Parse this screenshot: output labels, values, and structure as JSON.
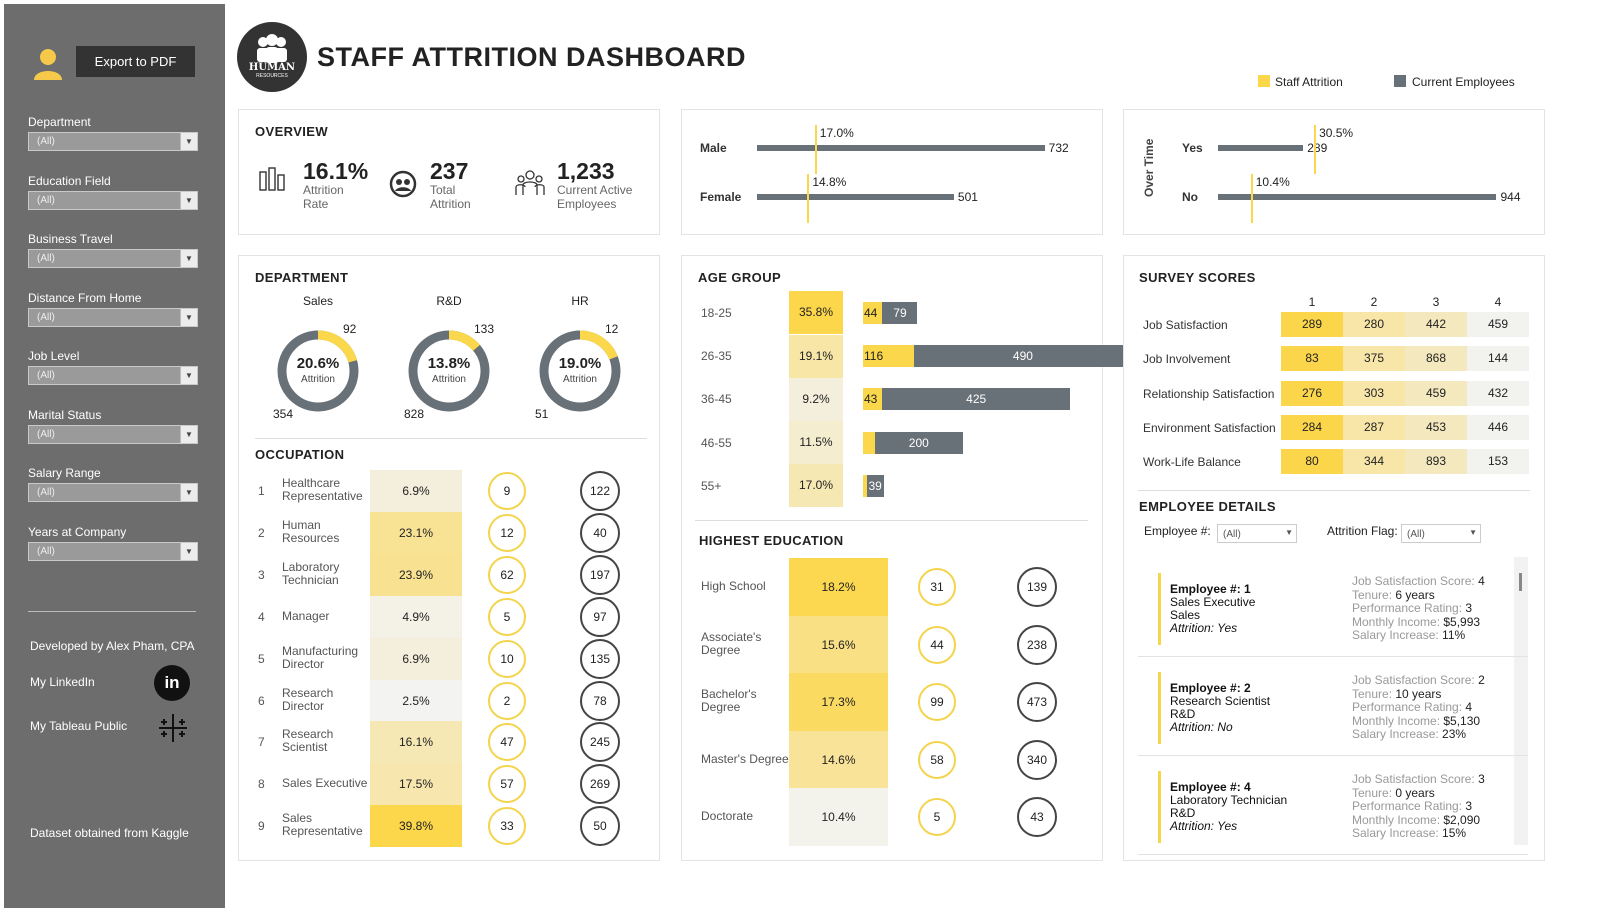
{
  "header": {
    "title": "STAFF ATTRITION DASHBOARD",
    "logo_text": "HUMAN",
    "logo_subtext": "RESOURCES"
  },
  "legend": {
    "attrition_label": "Staff Attrition",
    "current_label": "Current Employees",
    "attrition_color": "#fad74b",
    "current_color": "#687078"
  },
  "sidebar": {
    "export_label": "Export to PDF",
    "filters": [
      {
        "label": "Department",
        "value": "(All)"
      },
      {
        "label": "Education Field",
        "value": "(All)"
      },
      {
        "label": "Business Travel",
        "value": "(All)"
      },
      {
        "label": "Distance From Home",
        "value": "(All)"
      },
      {
        "label": "Job Level",
        "value": "(All)"
      },
      {
        "label": "Marital Status",
        "value": "(All)"
      },
      {
        "label": "Salary Range",
        "value": "(All)"
      },
      {
        "label": "Years at Company",
        "value": "(All)"
      }
    ],
    "developer": "Developed by Alex Pham, CPA",
    "linkedin_label": "My LinkedIn",
    "linkedin_icon": "in",
    "tableau_label": "My Tableau Public",
    "dataset_note": "Dataset obtained from Kaggle"
  },
  "overview": {
    "title": "OVERVIEW",
    "kpis": [
      {
        "value": "16.1%",
        "label1": "Attrition",
        "label2": "Rate"
      },
      {
        "value": "237",
        "label1": "Total",
        "label2": "Attrition"
      },
      {
        "value": "1,233",
        "label1": "Current Active",
        "label2": "Employees"
      }
    ]
  },
  "department": {
    "title": "DEPARTMENT",
    "sublabel": "Attrition",
    "items": [
      {
        "name": "Sales",
        "rate": "20.6%",
        "attrition": 92,
        "current": 354
      },
      {
        "name": "R&D",
        "rate": "13.8%",
        "attrition": 133,
        "current": 828
      },
      {
        "name": "HR",
        "rate": "19.0%",
        "attrition": 12,
        "current": 51
      }
    ]
  },
  "occupation": {
    "title": "OCCUPATION",
    "rows": [
      {
        "n": "1",
        "l1": "Healthcare",
        "l2": "Representative",
        "rate": "6.9%",
        "attr": "9",
        "cur": "122"
      },
      {
        "n": "2",
        "l1": "Human",
        "l2": "Resources",
        "rate": "23.1%",
        "attr": "12",
        "cur": "40"
      },
      {
        "n": "3",
        "l1": "Laboratory",
        "l2": "Technician",
        "rate": "23.9%",
        "attr": "62",
        "cur": "197"
      },
      {
        "n": "4",
        "l1": "Manager",
        "l2": "",
        "rate": "4.9%",
        "attr": "5",
        "cur": "97"
      },
      {
        "n": "5",
        "l1": "Manufacturing",
        "l2": "Director",
        "rate": "6.9%",
        "attr": "10",
        "cur": "135"
      },
      {
        "n": "6",
        "l1": "Research",
        "l2": "Director",
        "rate": "2.5%",
        "attr": "2",
        "cur": "78"
      },
      {
        "n": "7",
        "l1": "Research",
        "l2": "Scientist",
        "rate": "16.1%",
        "attr": "47",
        "cur": "245"
      },
      {
        "n": "8",
        "l1": "Sales Executive",
        "l2": "",
        "rate": "17.5%",
        "attr": "57",
        "cur": "269"
      },
      {
        "n": "9",
        "l1": "Sales",
        "l2": "Representative",
        "rate": "39.8%",
        "attr": "33",
        "cur": "50"
      }
    ]
  },
  "age_group": {
    "title": "AGE GROUP",
    "rows": [
      {
        "label": "18-25",
        "rate": "35.8%",
        "attr": 44,
        "cur": 79
      },
      {
        "label": "26-35",
        "rate": "19.1%",
        "attr": 116,
        "cur": 490
      },
      {
        "label": "36-45",
        "rate": "9.2%",
        "attr": 43,
        "cur": 425
      },
      {
        "label": "46-55",
        "rate": "11.5%",
        "attr": "",
        "cur": 200
      },
      {
        "label": "55+",
        "rate": "17.0%",
        "attr": "",
        "cur": 39
      }
    ]
  },
  "education": {
    "title": "HIGHEST EDUCATION",
    "rows": [
      {
        "l1": "High School",
        "l2": "",
        "rate": "18.2%",
        "attr": "31",
        "cur": "139"
      },
      {
        "l1": "Associate's",
        "l2": "Degree",
        "rate": "15.6%",
        "attr": "44",
        "cur": "238"
      },
      {
        "l1": "Bachelor's",
        "l2": "Degree",
        "rate": "17.3%",
        "attr": "99",
        "cur": "473"
      },
      {
        "l1": "Master's Degree",
        "l2": "",
        "rate": "14.6%",
        "attr": "58",
        "cur": "340"
      },
      {
        "l1": "Doctorate",
        "l2": "",
        "rate": "10.4%",
        "attr": "5",
        "cur": "43"
      }
    ]
  },
  "gender": {
    "rows": [
      {
        "label": "Male",
        "rate": "17.0%",
        "current": 732
      },
      {
        "label": "Female",
        "rate": "14.8%",
        "current": 501
      }
    ]
  },
  "overtime": {
    "axis_label": "Over Time",
    "rows": [
      {
        "label": "Yes",
        "rate": "30.5%",
        "current": 289
      },
      {
        "label": "No",
        "rate": "10.4%",
        "current": 944
      }
    ]
  },
  "survey": {
    "title": "SURVEY SCORES",
    "columns": [
      "1",
      "2",
      "3",
      "4"
    ],
    "rows": [
      {
        "label": "Job Satisfaction",
        "values": [
          "289",
          "280",
          "442",
          "459"
        ]
      },
      {
        "label": "Job Involvement",
        "values": [
          "83",
          "375",
          "868",
          "144"
        ]
      },
      {
        "label": "Relationship Satisfaction",
        "values": [
          "276",
          "303",
          "459",
          "432"
        ]
      },
      {
        "label": "Environment Satisfaction",
        "values": [
          "284",
          "287",
          "453",
          "446"
        ]
      },
      {
        "label": "Work-Life Balance",
        "values": [
          "80",
          "344",
          "893",
          "153"
        ]
      }
    ]
  },
  "employee_details": {
    "title": "EMPLOYEE DETAILS",
    "employee_filter_label": "Employee #:",
    "employee_filter_value": "(All)",
    "attrition_filter_label": "Attrition Flag:",
    "attrition_filter_value": "(All)",
    "cards": [
      {
        "id": "Employee #: 1",
        "role": "Sales Executive",
        "dept": "Sales",
        "attrition": "Attrition: Yes",
        "jss_l": "Job Satisfaction Score: ",
        "jss": "4",
        "ten_l": "Tenure: ",
        "ten": "6 years",
        "perf_l": "Performance Rating: ",
        "perf": "3",
        "inc_l": "Monthly Income: ",
        "inc": "$5,993",
        "sal_l": "Salary Increase: ",
        "sal": "11%"
      },
      {
        "id": "Employee #: 2",
        "role": "Research Scientist",
        "dept": "R&D",
        "attrition": "Attrition: No",
        "jss_l": "Job Satisfaction Score: ",
        "jss": "2",
        "ten_l": "Tenure: ",
        "ten": "10 years",
        "perf_l": "Performance Rating: ",
        "perf": "4",
        "inc_l": "Monthly Income: ",
        "inc": "$5,130",
        "sal_l": "Salary Increase: ",
        "sal": "23%"
      },
      {
        "id": "Employee #: 4",
        "role": "Laboratory Technician",
        "dept": "R&D",
        "attrition": "Attrition: Yes",
        "jss_l": "Job Satisfaction Score: ",
        "jss": "3",
        "ten_l": "Tenure: ",
        "ten": "0 years",
        "perf_l": "Performance Rating: ",
        "perf": "3",
        "inc_l": "Monthly Income: ",
        "inc": "$2,090",
        "sal_l": "Salary Increase: ",
        "sal": "15%"
      }
    ]
  },
  "chart_data": [
    {
      "type": "pie",
      "title": "DEPARTMENT",
      "series": [
        {
          "name": "Sales",
          "values": [
            92,
            354
          ]
        },
        {
          "name": "R&D",
          "values": [
            133,
            828
          ]
        },
        {
          "name": "HR",
          "values": [
            12,
            51
          ]
        }
      ]
    },
    {
      "type": "bar",
      "title": "AGE GROUP",
      "categories": [
        "18-25",
        "26-35",
        "36-45",
        "46-55",
        "55+"
      ],
      "series": [
        {
          "name": "Staff Attrition",
          "values": [
            44,
            116,
            43,
            26,
            8
          ]
        },
        {
          "name": "Current Employees",
          "values": [
            79,
            490,
            425,
            200,
            39
          ]
        }
      ]
    },
    {
      "type": "bar",
      "categories": [
        "Male",
        "Female"
      ],
      "series": [
        {
          "name": "Current Employees",
          "values": [
            732,
            501
          ]
        }
      ],
      "rates": [
        17.0,
        14.8
      ]
    },
    {
      "type": "bar",
      "categories": [
        "Yes",
        "No"
      ],
      "series": [
        {
          "name": "Current Employees",
          "values": [
            289,
            944
          ]
        }
      ],
      "rates": [
        30.5,
        10.4
      ]
    },
    {
      "type": "heatmap",
      "title": "OCCUPATION",
      "categories": [
        "Healthcare Representative",
        "Human Resources",
        "Laboratory Technician",
        "Manager",
        "Manufacturing Director",
        "Research Director",
        "Research Scientist",
        "Sales Executive",
        "Sales Representative"
      ],
      "values": [
        6.9,
        23.1,
        23.9,
        4.9,
        6.9,
        2.5,
        16.1,
        17.5,
        39.8
      ]
    },
    {
      "type": "heatmap",
      "title": "HIGHEST EDUCATION",
      "categories": [
        "High School",
        "Associate's Degree",
        "Bachelor's Degree",
        "Master's Degree",
        "Doctorate"
      ],
      "values": [
        18.2,
        15.6,
        17.3,
        14.6,
        10.4
      ]
    },
    {
      "type": "heatmap",
      "title": "SURVEY SCORES",
      "categories": [
        "Job Satisfaction",
        "Job Involvement",
        "Relationship Satisfaction",
        "Environment Satisfaction",
        "Work-Life Balance"
      ],
      "x": [
        1,
        2,
        3,
        4
      ],
      "values": [
        [
          289,
          280,
          442,
          459
        ],
        [
          83,
          375,
          868,
          144
        ],
        [
          276,
          303,
          459,
          432
        ],
        [
          284,
          287,
          453,
          446
        ],
        [
          80,
          344,
          893,
          153
        ]
      ]
    }
  ]
}
